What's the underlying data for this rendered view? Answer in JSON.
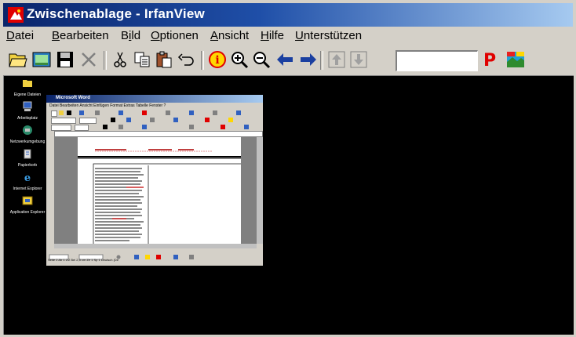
{
  "window": {
    "title": "Zwischenablage - IrfanView",
    "accent_color": "#0a246a"
  },
  "menu": [
    {
      "label": "Datei",
      "hotkey": "D"
    },
    {
      "label": "Bearbeiten",
      "hotkey": "B"
    },
    {
      "label": "Bild",
      "hotkey": "i"
    },
    {
      "label": "Optionen",
      "hotkey": "O"
    },
    {
      "label": "Ansicht",
      "hotkey": "A"
    },
    {
      "label": "Hilfe",
      "hotkey": "H"
    },
    {
      "label": "Unterstützen",
      "hotkey": "U"
    }
  ],
  "toolbar": {
    "buttons": [
      {
        "name": "open-folder-icon"
      },
      {
        "name": "slideshow-icon"
      },
      {
        "name": "save-icon"
      },
      {
        "name": "delete-icon"
      },
      {
        "name": "cut-icon"
      },
      {
        "name": "copy-icon"
      },
      {
        "name": "paste-icon"
      },
      {
        "name": "undo-icon"
      },
      {
        "name": "info-icon"
      },
      {
        "name": "zoom-in-icon"
      },
      {
        "name": "zoom-out-icon"
      },
      {
        "name": "previous-arrow-icon"
      },
      {
        "name": "next-arrow-icon"
      },
      {
        "name": "page-up-icon"
      },
      {
        "name": "page-down-icon"
      }
    ],
    "page_input_value": "",
    "print_letter": "P",
    "settings_icon": "paint-icon"
  },
  "desktop_icons": [
    {
      "label": "Eigene Dateien",
      "icon": "folder-icon"
    },
    {
      "label": "Arbeitsplatz",
      "icon": "computer-icon"
    },
    {
      "label": "Netzwerkumgebung",
      "icon": "network-icon"
    },
    {
      "label": "Papierkorb",
      "icon": "recycle-bin-icon"
    },
    {
      "label": "Internet Explorer",
      "icon": "ie-icon"
    },
    {
      "label": "Application Explorer",
      "icon": "explorer-icon"
    }
  ],
  "captured_window": {
    "title": "Microsoft Word",
    "menu_text": "Datei  Bearbeiten  Ansicht  Einfügen  Format  Extras  Tabelle  Fenster  ?",
    "status_text": "Seite 2    Ab 1    2/2    Bei 2,5 cm   Ze 1   Sp 1                Deutsch (De"
  }
}
